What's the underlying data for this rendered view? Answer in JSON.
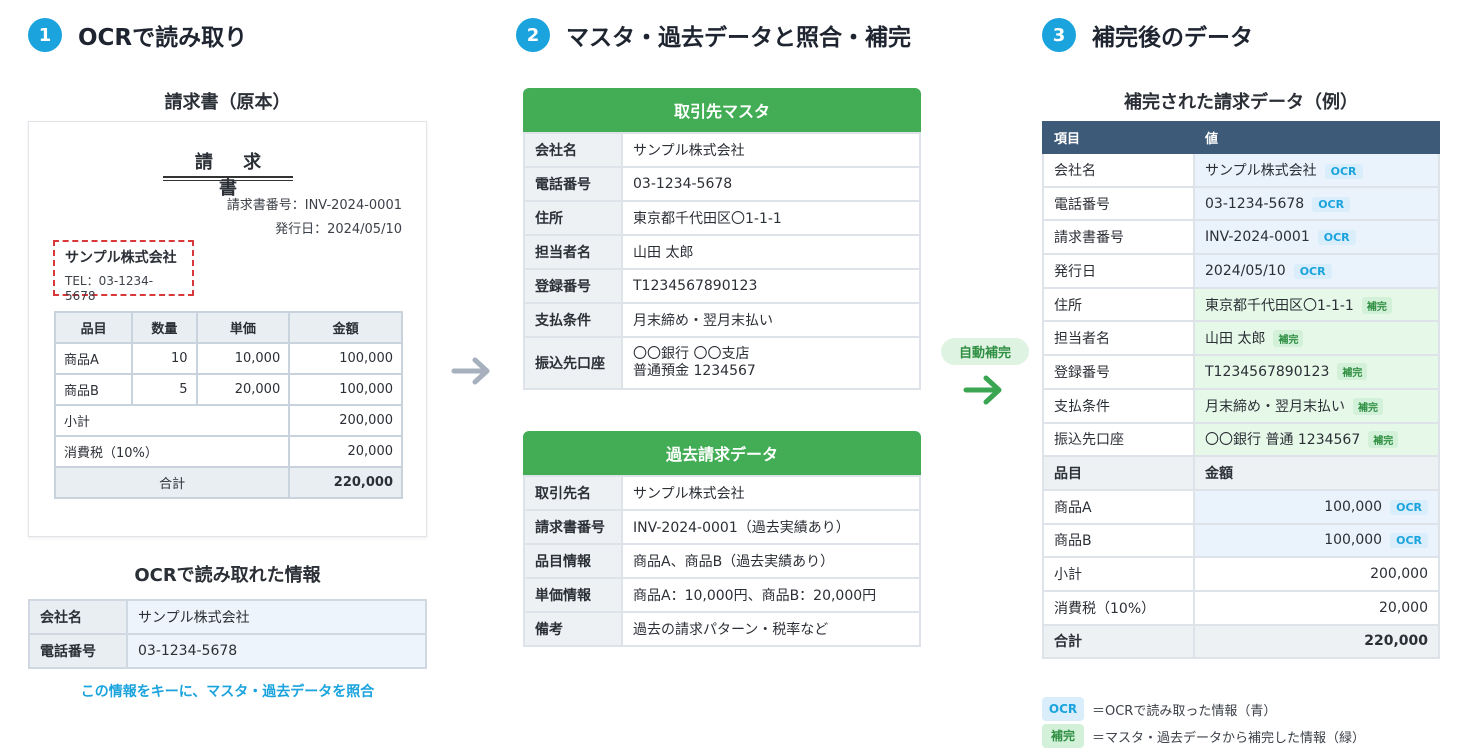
{
  "steps": [
    {
      "num": "1",
      "title": "OCRで読み取り"
    },
    {
      "num": "2",
      "title": "マスタ・過去データと照合・補完"
    },
    {
      "num": "3",
      "title": "補完後のデータ"
    }
  ],
  "invoice": {
    "heading": "請求書（原本）",
    "title": "請 求 書",
    "number_line": "請求書番号：INV-2024-0001",
    "date_line": "発行日：2024/05/10",
    "company": "サンプル株式会社",
    "tel": "TEL：03-1234-5678",
    "headers": [
      "品目",
      "数量",
      "単価",
      "金額"
    ],
    "rows": [
      [
        "商品A",
        "10",
        "10,000",
        "100,000"
      ],
      [
        "商品B",
        "5",
        "20,000",
        "100,000"
      ]
    ],
    "subtotal_label": "小計",
    "subtotal": "200,000",
    "tax_label": "消費税（10%）",
    "tax": "20,000",
    "total_label": "合計",
    "total": "220,000"
  },
  "ocr": {
    "heading": "OCRで読み取れた情報",
    "rows": [
      {
        "k": "会社名",
        "v": "サンプル株式会社"
      },
      {
        "k": "電話番号",
        "v": "03-1234-5678"
      }
    ],
    "note": "この情報をキーに、マスタ・過去データを照合"
  },
  "master": {
    "title": "取引先マスタ",
    "rows": [
      {
        "k": "会社名",
        "v": "サンプル株式会社"
      },
      {
        "k": "電話番号",
        "v": "03-1234-5678"
      },
      {
        "k": "住所",
        "v": "東京都千代田区〇1-1-1"
      },
      {
        "k": "担当者名",
        "v": "山田 太郎"
      },
      {
        "k": "登録番号",
        "v": "T1234567890123"
      },
      {
        "k": "支払条件",
        "v": "月末締め・翌月末払い"
      },
      {
        "k": "振込先口座",
        "v1": "〇〇銀行 〇〇支店",
        "v2": "普通預金 1234567"
      }
    ]
  },
  "history": {
    "title": "過去請求データ",
    "rows": [
      {
        "k": "取引先名",
        "v": "サンプル株式会社"
      },
      {
        "k": "請求書番号",
        "v": "INV-2024-0001（過去実績あり）"
      },
      {
        "k": "品目情報",
        "v": "商品A、商品B（過去実績あり）"
      },
      {
        "k": "単価情報",
        "v": "商品A：10,000円、商品B：20,000円"
      },
      {
        "k": "備考",
        "v": "過去の請求パターン・税率など"
      }
    ]
  },
  "auto_label": "自動補完",
  "result": {
    "heading": "補完された請求データ（例）",
    "header_item": "項目",
    "header_value": "値",
    "rows": [
      {
        "k": "会社名",
        "v": "サンプル株式会社",
        "tag": "OCR"
      },
      {
        "k": "電話番号",
        "v": "03-1234-5678",
        "tag": "OCR"
      },
      {
        "k": "請求書番号",
        "v": "INV-2024-0001",
        "tag": "OCR"
      },
      {
        "k": "発行日",
        "v": "2024/05/10",
        "tag": "OCR"
      },
      {
        "k": "住所",
        "v": "東京都千代田区〇1-1-1",
        "tag": "補完"
      },
      {
        "k": "担当者名",
        "v": "山田 太郎",
        "tag": "補完"
      },
      {
        "k": "登録番号",
        "v": "T1234567890123",
        "tag": "補完"
      },
      {
        "k": "支払条件",
        "v": "月末締め・翌月末払い",
        "tag": "補完"
      },
      {
        "k": "振込先口座",
        "v": "〇〇銀行 普通 1234567",
        "tag": "補完"
      }
    ],
    "section_item": "品目",
    "section_amount": "金額",
    "items": [
      {
        "k": "商品A",
        "v": "100,000",
        "tag": "OCR"
      },
      {
        "k": "商品B",
        "v": "100,000",
        "tag": "OCR"
      }
    ],
    "subtotal_label": "小計",
    "subtotal": "200,000",
    "tax_label": "消費税（10%）",
    "tax": "20,000",
    "total_label": "合計",
    "total": "220,000"
  },
  "legend": [
    {
      "badge": "OCR",
      "text": "＝OCRで読み取った情報（青）"
    },
    {
      "badge": "補完",
      "text": "＝マスタ・過去データから補完した情報（緑）"
    }
  ],
  "colors": {
    "accent": "#1aa3dd",
    "green": "#43ad55",
    "header_navy": "#3d5a78",
    "ocr_red": "#d9383a"
  }
}
